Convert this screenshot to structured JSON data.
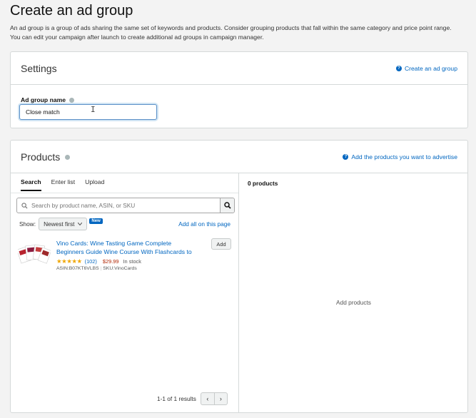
{
  "page": {
    "title": "Create an ad group",
    "description_line1": "An ad group is a group of ads sharing the same set of keywords and products. Consider grouping products that fall within the same category and price point range.",
    "description_line2": "You can edit your campaign after launch to create additional ad groups in campaign manager."
  },
  "settings": {
    "title": "Settings",
    "help_link": "Create an ad group",
    "field_label": "Ad group name",
    "field_value": "Close match"
  },
  "products": {
    "title": "Products",
    "help_link": "Add the products you want to advertise",
    "tabs": [
      "Search",
      "Enter list",
      "Upload"
    ],
    "active_tab": "Search",
    "search_placeholder": "Search by product name, ASIN, or SKU",
    "show_label": "Show:",
    "sort_value": "Newest first",
    "new_badge": "New",
    "add_all": "Add all on this page",
    "items": [
      {
        "title": "Vino Cards: Wine Tasting Game Complete Beginners Guide Wine Course With Flashcards to",
        "stars": "★★★★★",
        "rating": 4.5,
        "reviews": "(102)",
        "price": "$29.99",
        "stock": "In stock",
        "asin": "ASIN:B07KT6VLBS",
        "sku": "SKU:VinoCards",
        "add_label": "Add"
      }
    ],
    "results_text": "1-1 of 1 results",
    "prev_icon": "‹",
    "next_icon": "›",
    "added_count": "0 products",
    "empty_text": "Add products"
  },
  "colors": {
    "link": "#0066c0",
    "price": "#b12704",
    "star": "#f0a600",
    "badge": "#0066c0"
  }
}
